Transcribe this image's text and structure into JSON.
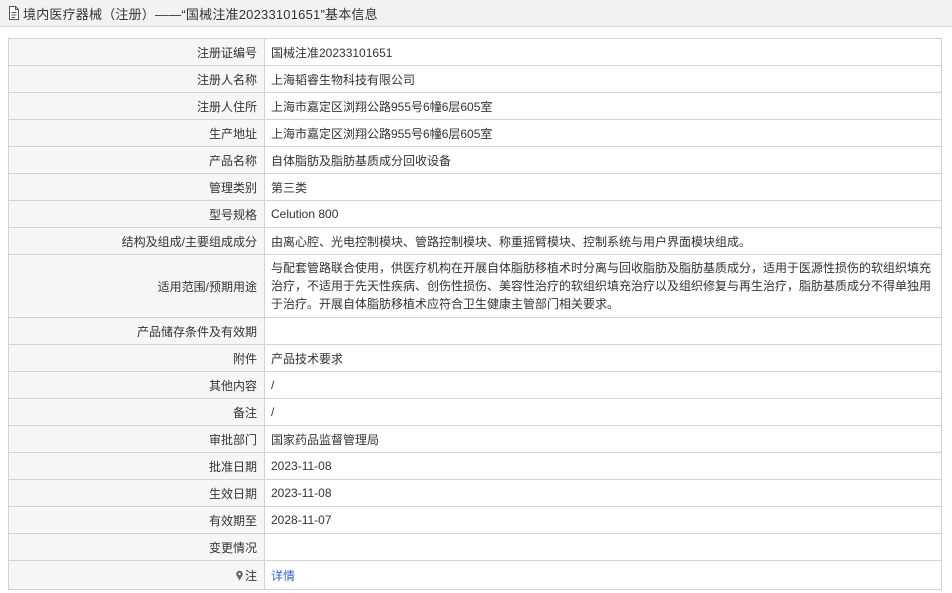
{
  "header": {
    "icon": "document-icon",
    "title": "境内医疗器械（注册）——“国械注准20233101651”基本信息"
  },
  "rows": [
    {
      "label": "注册证编号",
      "value": "国械注准20233101651"
    },
    {
      "label": "注册人名称",
      "value": "上海韬睿生物科技有限公司"
    },
    {
      "label": "注册人住所",
      "value": "上海市嘉定区浏翔公路955号6幢6层605室"
    },
    {
      "label": "生产地址",
      "value": "上海市嘉定区浏翔公路955号6幢6层605室"
    },
    {
      "label": "产品名称",
      "value": "自体脂肪及脂肪基质成分回收设备"
    },
    {
      "label": "管理类别",
      "value": "第三类"
    },
    {
      "label": "型号规格",
      "value": "Celution 800"
    },
    {
      "label": "结构及组成/主要组成成分",
      "value": "由离心腔、光电控制模块、管路控制模块、称重摇臂模块、控制系统与用户界面模块组成。"
    },
    {
      "label": "适用范围/预期用途",
      "value": "与配套管路联合使用，供医疗机构在开展自体脂肪移植术时分离与回收脂肪及脂肪基质成分，适用于医源性损伤的软组织填充治疗，不适用于先天性疾病、创伤性损伤、美容性治疗的软组织填充治疗以及组织修复与再生治疗，脂肪基质成分不得单独用于治疗。开展自体脂肪移植术应符合卫生健康主管部门相关要求。"
    },
    {
      "label": "产品储存条件及有效期",
      "value": ""
    },
    {
      "label": "附件",
      "value": "产品技术要求"
    },
    {
      "label": "其他内容",
      "value": "/"
    },
    {
      "label": "备注",
      "value": "/"
    },
    {
      "label": "审批部门",
      "value": "国家药品监督管理局"
    },
    {
      "label": "批准日期",
      "value": "2023-11-08"
    },
    {
      "label": "生效日期",
      "value": "2023-11-08"
    },
    {
      "label": "有效期至",
      "value": "2028-11-07"
    },
    {
      "label": "变更情况",
      "value": ""
    }
  ],
  "note": {
    "icon": "pin-icon",
    "label": "注",
    "link_text": "详情"
  }
}
